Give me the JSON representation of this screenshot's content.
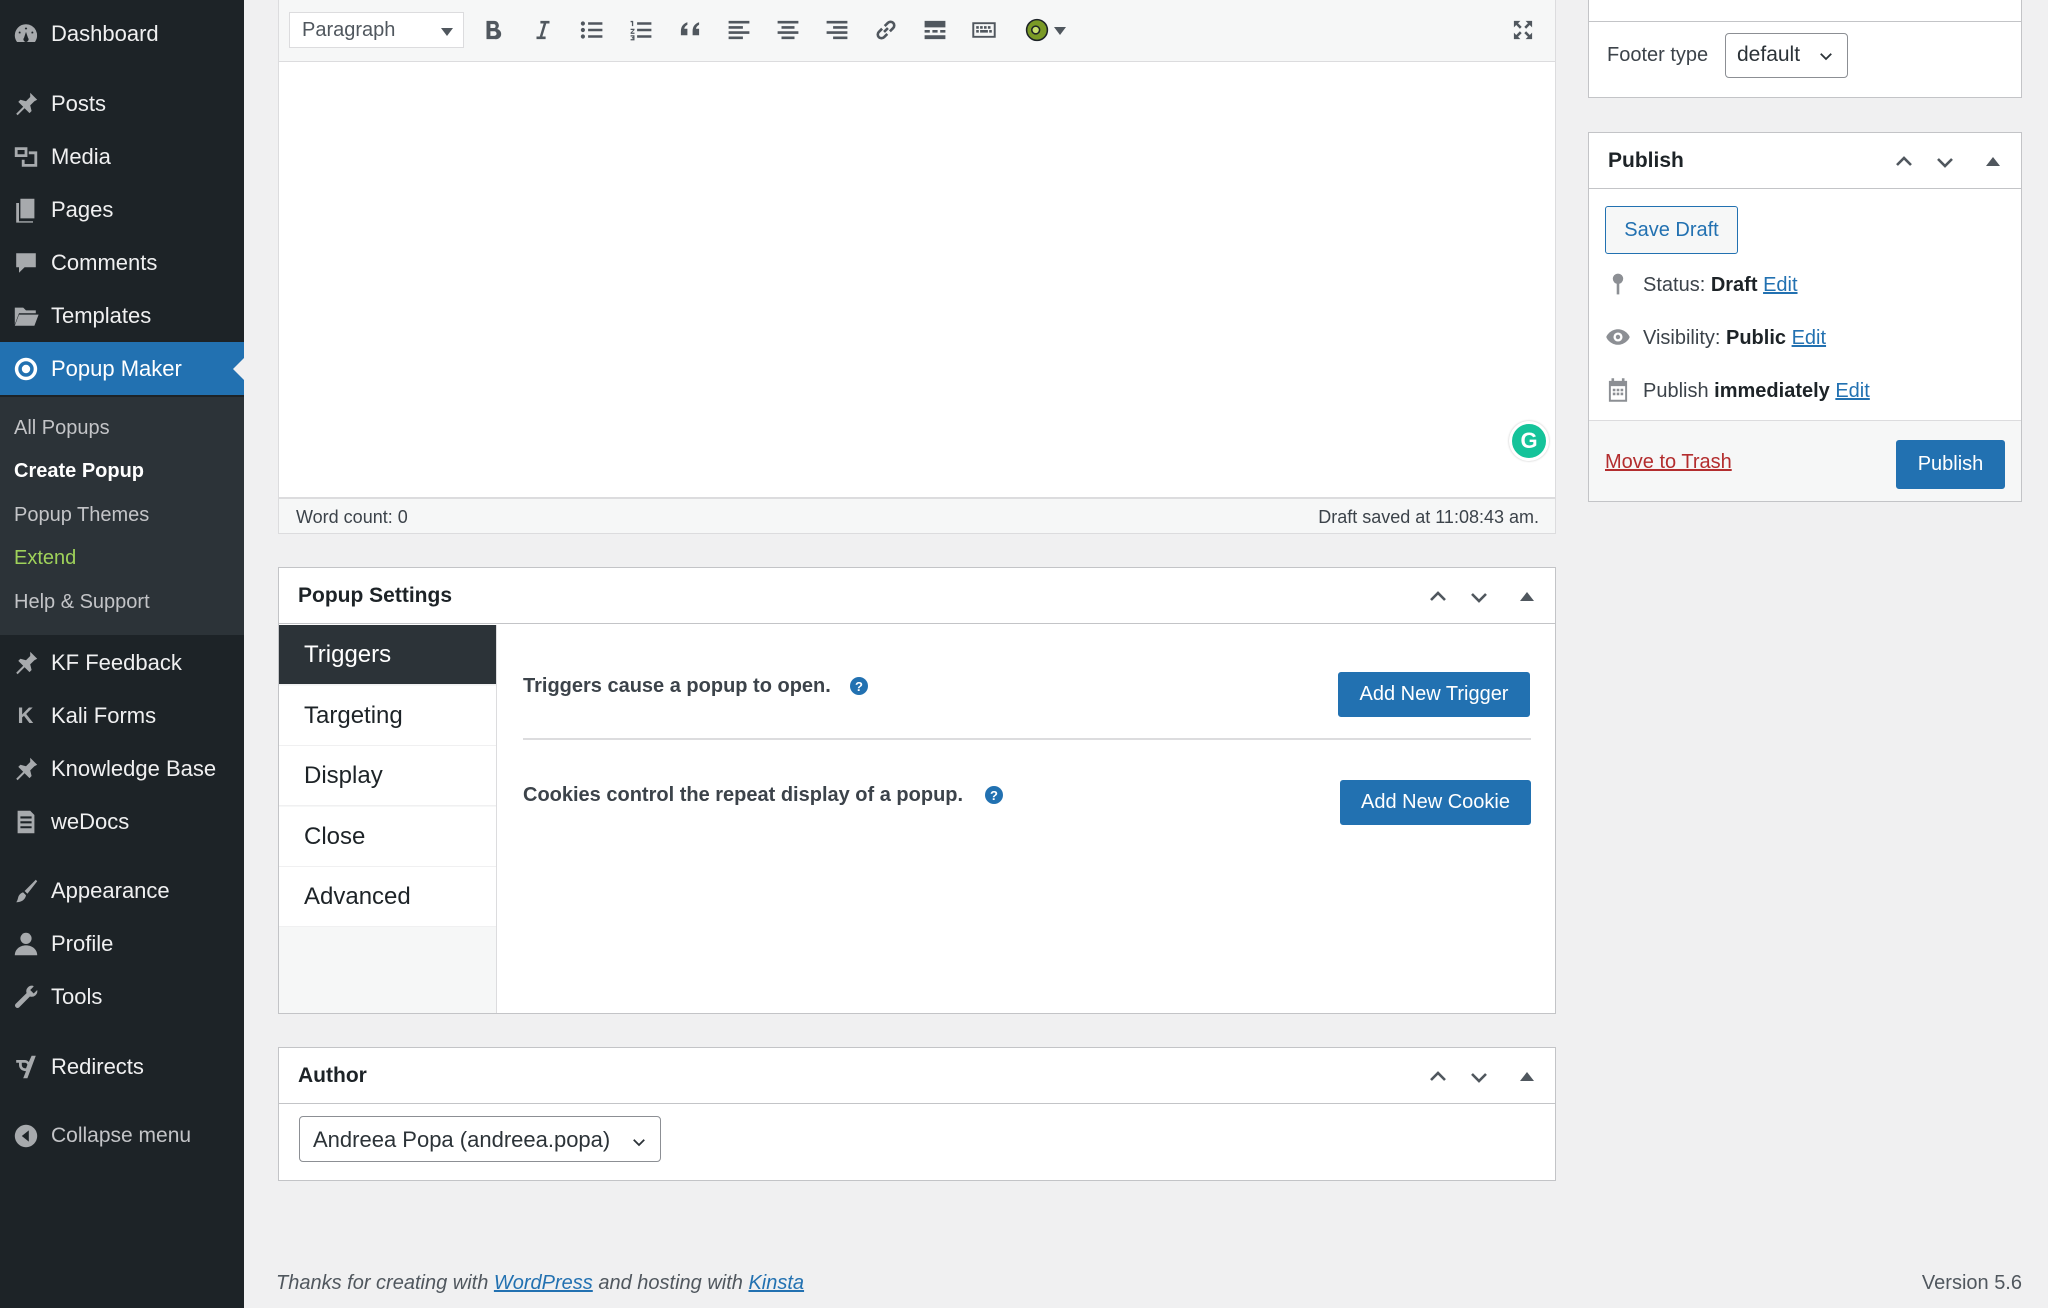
{
  "sidebar": {
    "items": [
      {
        "label": "Dashboard",
        "icon": "dashboard-icon"
      },
      {
        "label": "Posts",
        "icon": "pushpin-icon"
      },
      {
        "label": "Media",
        "icon": "media-icon"
      },
      {
        "label": "Pages",
        "icon": "pages-icon"
      },
      {
        "label": "Comments",
        "icon": "comment-icon"
      },
      {
        "label": "Templates",
        "icon": "folder-icon"
      },
      {
        "label": "Popup Maker",
        "icon": "popup-maker-icon"
      },
      {
        "label": "KF Feedback",
        "icon": "pushpin-icon"
      },
      {
        "label": "Kali Forms",
        "icon": "kali-forms-icon"
      },
      {
        "label": "Knowledge Base",
        "icon": "pushpin-icon"
      },
      {
        "label": "weDocs",
        "icon": "document-icon"
      },
      {
        "label": "Appearance",
        "icon": "paintbrush-icon"
      },
      {
        "label": "Profile",
        "icon": "user-icon"
      },
      {
        "label": "Tools",
        "icon": "wrench-icon"
      },
      {
        "label": "Redirects",
        "icon": "yoast-icon"
      },
      {
        "label": "Collapse menu",
        "icon": "collapse-icon"
      }
    ],
    "submenu": [
      "All Popups",
      "Create Popup",
      "Popup Themes",
      "Extend",
      "Help & Support"
    ],
    "kali_letter": "K"
  },
  "editor": {
    "format": "Paragraph",
    "word_count": "Word count: 0",
    "draft_saved": "Draft saved at 11:08:43 am.",
    "grammarly_letter": "G"
  },
  "popup_settings": {
    "title": "Popup Settings",
    "tabs": [
      "Triggers",
      "Targeting",
      "Display",
      "Close",
      "Advanced"
    ],
    "triggers_text": "Triggers cause a popup to open.",
    "cookies_text": "Cookies control the repeat display of a popup.",
    "add_trigger": "Add New Trigger",
    "add_cookie": "Add New Cookie",
    "help": "?"
  },
  "author": {
    "title": "Author",
    "selected": "Andreea Popa (andreea.popa)"
  },
  "layout_options": {
    "footer_label": "Footer type",
    "footer_value": "default"
  },
  "publish": {
    "title": "Publish",
    "save_draft": "Save Draft",
    "status_label": "Status:",
    "status_value": "Draft",
    "visibility_label": "Visibility:",
    "visibility_value": "Public",
    "schedule_label": "Publish",
    "schedule_value": "immediately",
    "edit": "Edit",
    "move_to_trash": "Move to Trash",
    "publish_button": "Publish"
  },
  "footer": {
    "prefix": "Thanks for creating with",
    "wordpress": "WordPress",
    "middle": "and hosting with",
    "kinsta": "Kinsta",
    "version": "Version 5.6"
  }
}
